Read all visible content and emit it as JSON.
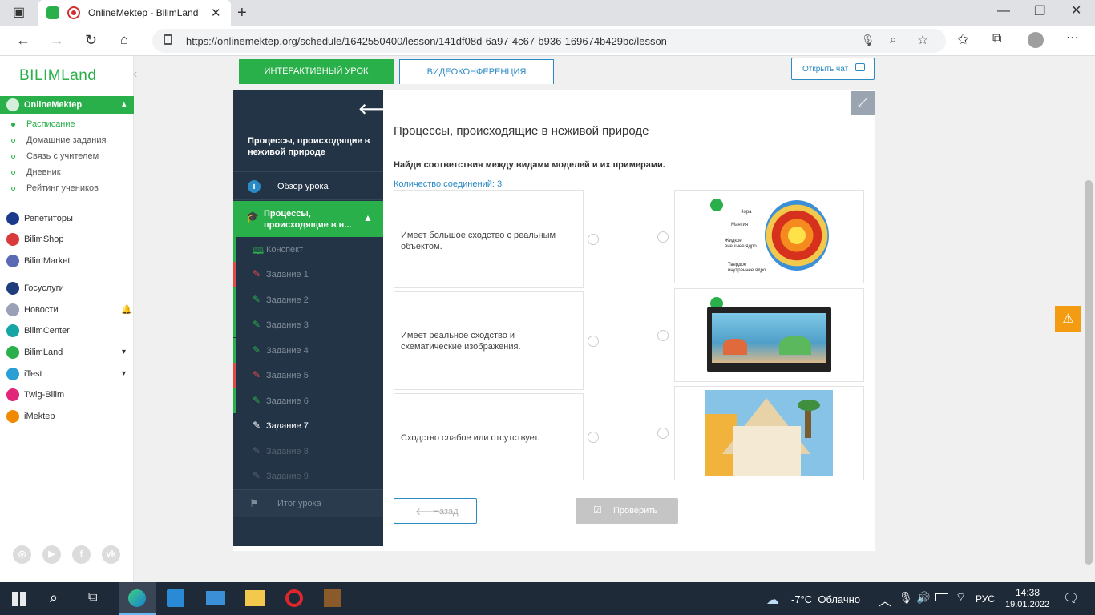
{
  "browser": {
    "tab_title": "OnlineMektep - BilimLand",
    "url": "https://onlinemektep.org/schedule/1642550400/lesson/141df08d-6a97-4c67-b936-169674b429bc/lesson",
    "icons": [
      "back-icon",
      "forward-icon",
      "refresh-icon",
      "home-icon",
      "lock-icon",
      "mic-icon",
      "zoom-icon",
      "favorite-add-icon",
      "favorites-icon",
      "collections-icon",
      "profile-icon",
      "more-icon"
    ]
  },
  "sidebar": {
    "logo": "BILIMLand",
    "section": "OnlineMektep",
    "sub_items": [
      "Расписание",
      "Домашние задания",
      "Связь с учителем",
      "Дневник",
      "Рейтинг учеников"
    ],
    "items": [
      {
        "label": "Репетиторы",
        "color": "#1b3a8c"
      },
      {
        "label": "BilimShop",
        "color": "#d93b3b"
      },
      {
        "label": "BilimMarket",
        "color": "#5b6bb3"
      },
      {
        "label": "Госуслуги",
        "color": "#1f3d7a"
      },
      {
        "label": "Новости",
        "color": "#9aa0b5"
      },
      {
        "label": "BilimCenter",
        "color": "#16a4a4"
      },
      {
        "label": "BilimLand",
        "color": "#2ab04a"
      },
      {
        "label": "iTest",
        "color": "#2a9fd6"
      },
      {
        "label": "Twig-Bilim",
        "color": "#e0257a"
      },
      {
        "label": "iMektep",
        "color": "#f08a00"
      }
    ]
  },
  "main": {
    "tab_interactive": "ИНТЕРАКТИВНЫЙ УРОК",
    "tab_video": "ВИДЕОКОНФЕРЕНЦИЯ",
    "open_chat": "Открыть чат",
    "lesson_nav": {
      "title": "Процессы, происходящие в неживой природе",
      "overview": "Обзор урока",
      "current_section": "Процессы, происходящие в н...",
      "items": [
        {
          "label": "Конспект",
          "status": "green",
          "icon": "book-icon"
        },
        {
          "label": "Задание 1",
          "status": "red",
          "icon": "edit-icon"
        },
        {
          "label": "Задание 2",
          "status": "green",
          "icon": "edit-icon"
        },
        {
          "label": "Задание 3",
          "status": "green",
          "icon": "edit-icon"
        },
        {
          "label": "Задание 4",
          "status": "green",
          "icon": "edit-icon"
        },
        {
          "label": "Задание 5",
          "status": "red",
          "icon": "edit-icon"
        },
        {
          "label": "Задание 6",
          "status": "green",
          "icon": "edit-icon"
        },
        {
          "label": "Задание 7",
          "status": "active",
          "icon": "edit-icon"
        },
        {
          "label": "Задание 8",
          "status": "none",
          "icon": "edit-icon"
        },
        {
          "label": "Задание 9",
          "status": "none",
          "icon": "edit-icon"
        }
      ],
      "summary": "Итог урока"
    },
    "task": {
      "title": "Процессы, происходящие в неживой природе",
      "instruction": "Найди соответствия между видами моделей и их примерами.",
      "connections": "Количество соединений: 3",
      "left": [
        "Имеет большое сходство с реальным объектом.",
        "Имеет реальное сходство и схематические изображения.",
        "Сходство слабое или отсутствует."
      ],
      "earth_labels": [
        "Кора",
        "Мантия",
        "Жидкое внешнее ядро",
        "Твердое внутреннее ядро"
      ],
      "back": "Назад",
      "check": "Проверить"
    }
  },
  "taskbar": {
    "weather": "-7°C  Облачно",
    "lang": "РУС",
    "time": "14:38",
    "date": "19.01.2022"
  }
}
